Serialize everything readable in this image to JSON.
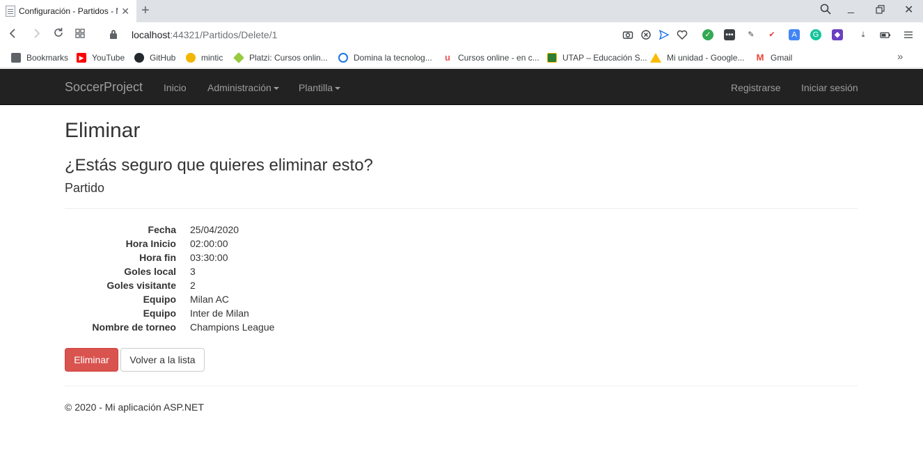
{
  "browser": {
    "tab_title": "Configuración - Partidos - M",
    "url_host": "localhost",
    "url_rest": ":44321/Partidos/Delete/1",
    "bookmarks": [
      {
        "label": "Bookmarks",
        "icon": "bookmark-page-icon",
        "color": "#5f6368"
      },
      {
        "label": "YouTube",
        "icon": "youtube-icon",
        "color": "#ff0000"
      },
      {
        "label": "GitHub",
        "icon": "github-icon",
        "color": "#24292e"
      },
      {
        "label": "mintic",
        "icon": "mintic-icon",
        "color": "#f2b705"
      },
      {
        "label": "Platzi: Cursos onlin...",
        "icon": "platzi-icon",
        "color": "#98ca3f"
      },
      {
        "label": "Domina la tecnolog...",
        "icon": "domina-icon",
        "color": "#1a73e8"
      },
      {
        "label": "Cursos online - en c...",
        "icon": "udemy-icon",
        "color": "#ec5252"
      },
      {
        "label": "UTAP – Educación S...",
        "icon": "utap-icon",
        "color": "#2e7d32"
      },
      {
        "label": "Mi unidad - Google...",
        "icon": "google-drive-icon",
        "color": "#fbbc04"
      },
      {
        "label": "Gmail",
        "icon": "gmail-icon",
        "color": "#ea4335"
      }
    ]
  },
  "navbar": {
    "brand": "SoccerProject",
    "links": [
      "Inicio",
      "Administración",
      "Plantilla"
    ],
    "right_links": [
      "Registrarse",
      "Iniciar sesión"
    ]
  },
  "page": {
    "title": "Eliminar",
    "question": "¿Estás seguro que quieres eliminar esto?",
    "entity": "Partido",
    "fields": [
      {
        "label": "Fecha",
        "value": "25/04/2020"
      },
      {
        "label": "Hora Inicio",
        "value": "02:00:00"
      },
      {
        "label": "Hora fin",
        "value": "03:30:00"
      },
      {
        "label": "Goles local",
        "value": "3"
      },
      {
        "label": "Goles visitante",
        "value": "2"
      },
      {
        "label": "Equipo",
        "value": "Milan AC"
      },
      {
        "label": "Equipo",
        "value": "Inter de Milan"
      },
      {
        "label": "Nombre de torneo",
        "value": "Champions League"
      }
    ],
    "delete_button": "Eliminar",
    "back_button": "Volver a la lista"
  },
  "footer": {
    "text": "© 2020 - Mi aplicación ASP.NET"
  },
  "colors": {
    "navbar_bg": "#222222",
    "navbar_text": "#9d9d9d",
    "danger": "#d9534f"
  }
}
